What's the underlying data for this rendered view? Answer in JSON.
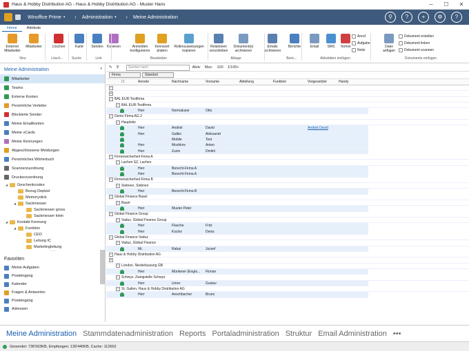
{
  "window": {
    "title": "Haus & Hobby Distribution AG - Haus & Hobby Distribution AG - Muster Hans",
    "min": "─",
    "max": "☐",
    "close": "✕"
  },
  "nav": {
    "product": "Winoffice Prime",
    "module": "Administration",
    "page": "Meine Administration",
    "dd": "▾",
    "sep": "›"
  },
  "navicons": [
    "⚲",
    "?",
    "+",
    "⚙",
    "?"
  ],
  "tabs": [
    "Home",
    "Attribute"
  ],
  "ribbon": {
    "buttons": [
      {
        "label": "Externer Mitarbeiter",
        "color": "#e59a2a"
      },
      {
        "label": "Mitarbeiter",
        "color": "#e59a2a"
      },
      {
        "label": "Löschen",
        "color": "#d03030"
      },
      {
        "label": "Karte",
        "color": "#4a7fc0"
      },
      {
        "label": "Senden",
        "color": "#4a7fc0"
      },
      {
        "label": "Kopieren",
        "color": "#b070c0"
      },
      {
        "label": "Anmelden konfigurieren",
        "color": "#e0a020"
      },
      {
        "label": "Kennwort ändern",
        "color": "#e0a020"
      },
      {
        "label": "Rollenzuweisungen kopieren",
        "color": "#5aa0d0"
      },
      {
        "label": "Relationen verschieben",
        "color": "#5a80b0"
      },
      {
        "label": "Dokument(e) archivieren",
        "color": "#7a9ac0"
      },
      {
        "label": "Emails archivieren",
        "color": "#5a80b0"
      },
      {
        "label": "Berichte",
        "color": "#4a7fc0"
      },
      {
        "label": "Email",
        "color": "#7a9ac0"
      },
      {
        "label": "SMS",
        "color": "#4a90d0"
      },
      {
        "label": "Termin",
        "color": "#d04040"
      },
      {
        "label": "Datei anfügen",
        "color": "#7a9ac0"
      }
    ],
    "small": [
      "Anruf",
      "Aufgabe",
      "Notiz",
      "Dokument erstellen",
      "Dokument linken",
      "Dokument scannen"
    ],
    "groups": [
      "Neu",
      "Lösch...",
      "Suche",
      "Link",
      "Bearbeiten",
      "Ablage",
      "Beric...",
      "Aktivitäten einfügen",
      "Dokumente einfügen"
    ]
  },
  "sidebar": {
    "title": "Meine Administration",
    "pin": "▾",
    "items": [
      {
        "label": "Mitarbeiter",
        "color": "#2f9a56",
        "selected": true
      },
      {
        "label": "Teams",
        "color": "#2f9a56"
      },
      {
        "label": "Externe Konten",
        "color": "#2f9a56"
      },
      {
        "label": "Persönliche Verteiler",
        "color": "#e59a2a"
      },
      {
        "label": "Blockierte Sender",
        "color": "#d03030"
      },
      {
        "label": "Meine Emailkonten",
        "color": "#4a7fc0"
      },
      {
        "label": "Meine vCards",
        "color": "#4a7fc0"
      },
      {
        "label": "Meine Kennungen",
        "color": "#b070c0"
      },
      {
        "label": "Abgeschlossene Meldungen",
        "color": "#e0a020"
      },
      {
        "label": "Persönliches Wörterbuch",
        "color": "#4a7fc0"
      },
      {
        "label": "Scannerzuordnung",
        "color": "#666666"
      },
      {
        "label": "Druckerzuordnung",
        "color": "#666666"
      }
    ],
    "tree": [
      {
        "label": "Geschenkcodes",
        "level": 0,
        "arrow": "◢"
      },
      {
        "label": "Bezug Deplzel",
        "level": 1,
        "arrow": ""
      },
      {
        "label": "Memorystick",
        "level": 1,
        "arrow": ""
      },
      {
        "label": "Sackmesser",
        "level": 1,
        "arrow": "◢"
      },
      {
        "label": "Sackmesser gross",
        "level": 2,
        "arrow": ""
      },
      {
        "label": "Sackmesser klein",
        "level": 2,
        "arrow": ""
      },
      {
        "label": "Kontakt Kennung",
        "level": 0,
        "arrow": "◢"
      },
      {
        "label": "Funktion",
        "level": 1,
        "arrow": "◢"
      },
      {
        "label": "CEO",
        "level": 2,
        "arrow": ""
      },
      {
        "label": "Leitung IC",
        "level": 2,
        "arrow": ""
      },
      {
        "label": "Marketingleitung",
        "level": 2,
        "arrow": ""
      }
    ],
    "divider": "·····",
    "favtitle": "Favoriten",
    "favorites": [
      {
        "label": "Meine Aufgaben",
        "color": "#4a7fc0"
      },
      {
        "label": "Posteingang",
        "color": "#4a7fc0"
      },
      {
        "label": "Kalender",
        "color": "#4a7fc0"
      },
      {
        "label": "Fragen & Antworten",
        "color": "#e0a020"
      },
      {
        "label": "Posteingang",
        "color": "#4a7fc0"
      },
      {
        "label": "Adressen",
        "color": "#4a7fc0"
      }
    ]
  },
  "toolbar": {
    "search_placeholder": "Suchen nach",
    "aktiv": "Aktiv",
    "max": "Max.",
    "max_val": "100",
    "page": "1/100+",
    "pencil": "✎",
    "filter": "⚲"
  },
  "groupby": [
    "Firma",
    "Standort"
  ],
  "columns": [
    "Anrede",
    "Nachname",
    "Vorname",
    "Abteilung",
    "Funktion",
    "Vorgesetzter",
    "Handy"
  ],
  "rows": [
    {
      "t": "e"
    },
    {
      "t": "e",
      "s": "+"
    },
    {
      "t": "g",
      "l": "BAL EUR-Testfirma",
      "lv": 0
    },
    {
      "t": "g",
      "l": "BAL EUR-Testfirma",
      "lv": 1
    },
    {
      "t": "d",
      "a": "Herr",
      "n": "Normaluser",
      "v": "Otto"
    },
    {
      "t": "g",
      "l": "Demo Firma AG 2",
      "lv": 0
    },
    {
      "t": "g",
      "l": "Hauptsitz",
      "lv": 1
    },
    {
      "t": "d",
      "a": "Herr",
      "n": "Andrist",
      "v": "David",
      "vg": "Andrist David"
    },
    {
      "t": "d",
      "a": "Herr",
      "n": "Galkin",
      "v": "Aleksandr"
    },
    {
      "t": "d",
      "a": "",
      "n": "Mobile",
      "v": "Test"
    },
    {
      "t": "d",
      "a": "Herr",
      "n": "Moshkov",
      "v": "Anton"
    },
    {
      "t": "d",
      "a": "Herr",
      "n": "Zuzin",
      "v": "Dmitrii"
    },
    {
      "t": "g",
      "l": "Firmensicherheit Firma A",
      "lv": 0
    },
    {
      "t": "g",
      "l": "Lachen SZ, Lachen",
      "lv": 1
    },
    {
      "t": "d",
      "a": "Herr",
      "n": "Berecht-Firma A",
      "v": ""
    },
    {
      "t": "d",
      "a": "Herr",
      "n": "Berecht-Firma A",
      "v": ""
    },
    {
      "t": "g",
      "l": "Firmensicherheit Firma B",
      "lv": 0
    },
    {
      "t": "g",
      "l": "Siebnen, Siebnen",
      "lv": 1
    },
    {
      "t": "d",
      "a": "Herr",
      "n": "Berecht-Firma B",
      "v": ""
    },
    {
      "t": "g",
      "l": "Global Finance Basel",
      "lv": 0
    },
    {
      "t": "g",
      "l": "Basel",
      "lv": 1
    },
    {
      "t": "d",
      "a": "Herr",
      "n": "Muster Peter",
      "v": ""
    },
    {
      "t": "g",
      "l": "Global Finance Group",
      "lv": 0
    },
    {
      "t": "g",
      "l": "Vaduz, Global Finance Group",
      "lv": 1
    },
    {
      "t": "d",
      "a": "Herr",
      "n": "Flasche",
      "v": "Fritz"
    },
    {
      "t": "d",
      "a": "Herr",
      "n": "Kozlov",
      "v": "Denis"
    },
    {
      "t": "g",
      "l": "Global Finance Vaduz",
      "lv": 0
    },
    {
      "t": "g",
      "l": "Vaduz, Global Finance",
      "lv": 1
    },
    {
      "t": "d",
      "a": "Mr.",
      "n": "Rabai",
      "v": "Jozsef"
    },
    {
      "t": "g",
      "l": "Haus & Hobby Distribution AG",
      "lv": 0
    },
    {
      "t": "e",
      "s": "+"
    },
    {
      "t": "g",
      "l": "London, Niederlassung GB",
      "lv": 1
    },
    {
      "t": "d",
      "a": "Herr",
      "n": "Müntener (Engla...",
      "v": "Florian"
    },
    {
      "t": "g",
      "l": "Schwyz, Zweigstelle Schwyz",
      "lv": 1
    },
    {
      "t": "d",
      "a": "Herr",
      "n": "Urner",
      "v": "Gustav"
    },
    {
      "t": "g",
      "l": "St. Gallen, Haus & Hobby Distribution AG",
      "lv": 1
    },
    {
      "t": "d",
      "a": "Herr",
      "n": "Aeschbacher",
      "v": "Bruno"
    }
  ],
  "bottomtabs": [
    "Meine Administration",
    "Stammdatenadministration",
    "Reports",
    "Portaladministration",
    "Struktur",
    "Email Administration",
    "•••"
  ],
  "status": "Gesendet: 736'663KB, Empfangen: 139'440KB, Cache: 112662"
}
